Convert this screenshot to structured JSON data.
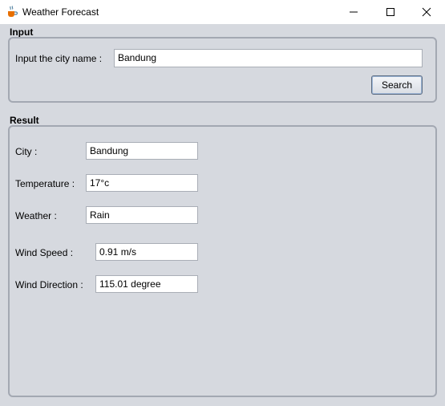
{
  "window": {
    "title": "Weather Forecast",
    "icon": "java-coffee-icon",
    "controls": [
      "minimize-icon",
      "maximize-icon",
      "close-icon"
    ]
  },
  "input": {
    "section_label": "Input",
    "city_label": "Input the city name :",
    "city_value": "Bandung",
    "search_label": "Search"
  },
  "result": {
    "section_label": "Result",
    "city_label": "City :",
    "city_value": "Bandung",
    "temperature_label": "Temperature :",
    "temperature_value": "17°c",
    "weather_label": "Weather :",
    "weather_value": "Rain",
    "wind_speed_label": "Wind Speed :",
    "wind_speed_value": "0.91 m/s",
    "wind_direction_label": "Wind Direction :",
    "wind_direction_value": "115.01 degree"
  },
  "colors": {
    "background": "#d6d9df",
    "titlebar": "#ffffff",
    "border": "#a3a8b2"
  }
}
